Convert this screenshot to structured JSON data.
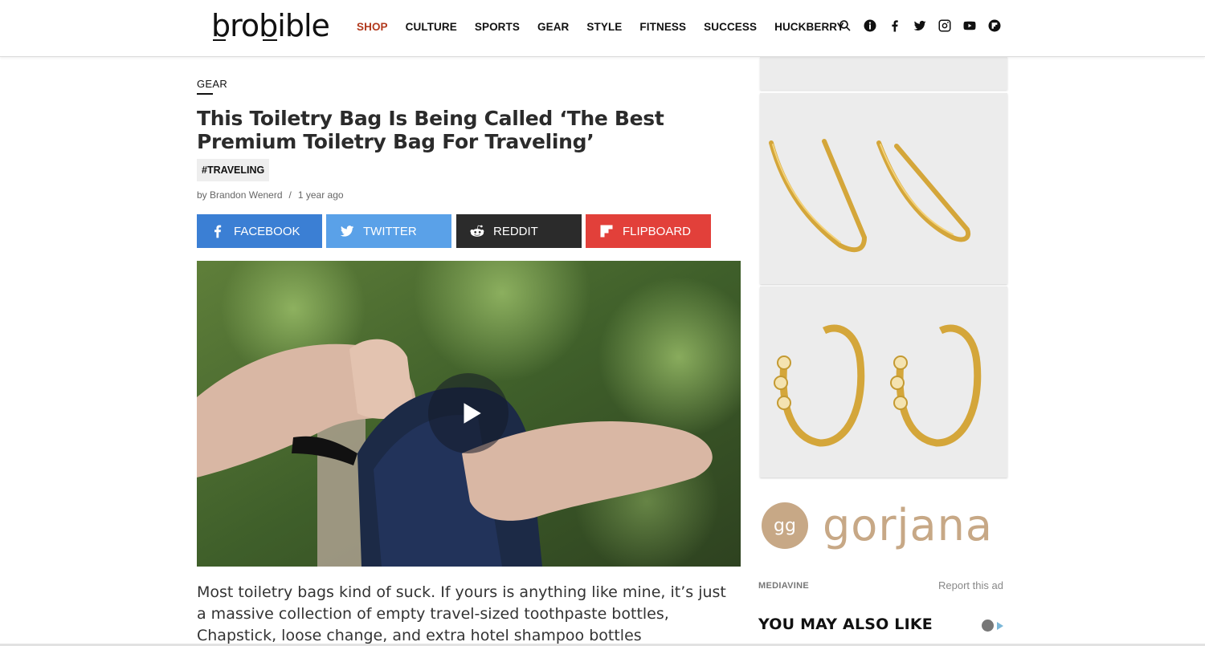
{
  "header": {
    "logo": "brobible",
    "nav": [
      {
        "label": "SHOP",
        "active": true
      },
      {
        "label": "CULTURE",
        "active": false
      },
      {
        "label": "SPORTS",
        "active": false
      },
      {
        "label": "GEAR",
        "active": false
      },
      {
        "label": "STYLE",
        "active": false
      },
      {
        "label": "FITNESS",
        "active": false
      },
      {
        "label": "SUCCESS",
        "active": false
      },
      {
        "label": "HUCKBERRY",
        "active": false
      }
    ],
    "icons": [
      "search-icon",
      "info-icon",
      "facebook-icon",
      "twitter-icon",
      "instagram-icon",
      "youtube-icon",
      "flipboard-icon"
    ],
    "active_color": "#b23a1e"
  },
  "article": {
    "category": "GEAR",
    "title": "This Toiletry Bag Is Being Called ‘The Best Premium Toiletry Bag For Traveling’",
    "tag": "#TRAVELING",
    "author": "by Brandon Wenerd",
    "separator": "/",
    "time": "1 year ago",
    "share": {
      "facebook": "FACEBOOK",
      "twitter": "TWITTER",
      "reddit": "REDDIT",
      "flipboard": "FLIPBOARD"
    },
    "body": "Most toiletry bags kind of suck. If yours is anything like mine, it’s just a massive collection of empty travel-sized toothpaste bottles, Chapstick, loose change, and extra hotel shampoo bottles haphazardly toss"
  },
  "sidebar": {
    "brand": "gorjana",
    "brand_monogram": "gg",
    "mediavine": "MEDIAVINE",
    "report": "Report this ad",
    "also_like": "YOU MAY ALSO LIKE"
  },
  "colors": {
    "facebook": "#3b7fd4",
    "twitter": "#5aa1e8",
    "reddit": "#2b2b2b",
    "flipboard": "#e2403a",
    "brand": "#c7a886"
  }
}
